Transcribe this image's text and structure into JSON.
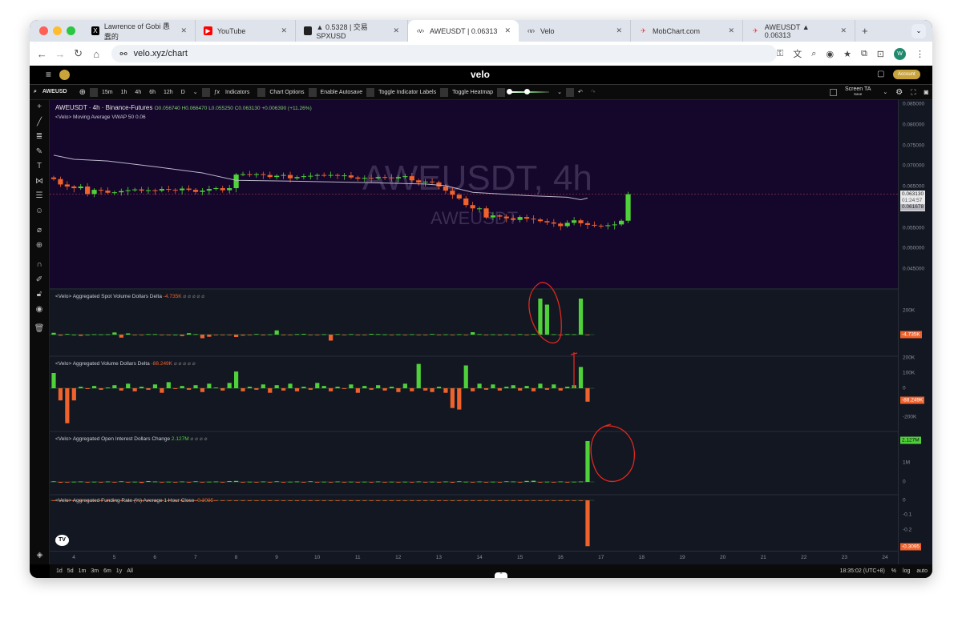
{
  "browser": {
    "tabs": [
      {
        "label": "Lawrence of Gobi 愚蠢的",
        "icon": "x-logo-icon"
      },
      {
        "label": "YouTube",
        "icon": "youtube-icon"
      },
      {
        "label": "▲ 0.5328 | 交易 SPXUSD",
        "icon": "exchange-icon"
      },
      {
        "label": "AWEUSDT | 0.06313",
        "icon": "velo-icon",
        "active": true
      },
      {
        "label": "Velo",
        "icon": "velo-icon"
      },
      {
        "label": "MobChart.com",
        "icon": "mobchart-icon"
      },
      {
        "label": "AWEUSDT ▲ 0.06313",
        "icon": "mobchart-icon"
      }
    ],
    "url": "velo.xyz/chart",
    "profile_initial": "W"
  },
  "app": {
    "logo": "velo",
    "account_label": "Account"
  },
  "toolbar": {
    "symbol": "AWEUSD",
    "intervals": [
      "15m",
      "1h",
      "4h",
      "6h",
      "12h",
      "D"
    ],
    "indicators": "Indicators",
    "chart_options": "Chart Options",
    "autosave": "Enable Autosave",
    "toggle_labels": "Toggle Indicator Labels",
    "toggle_heatmap": "Toggle Heatmap",
    "screen_ta": "Screen TA",
    "save": "Save"
  },
  "main": {
    "title": "AWEUSDT · 4h · Binance-Futures",
    "ohlc": "O0.056740  H0.066470  L0.055250  C0.063130  +0.006390 (+11.26%)",
    "ma_label": "<Velo> Moving Average VWAP 50 0.06",
    "watermark": "AWEUSDT, 4h",
    "watermark_sub": "AWEUSDT",
    "price_ticks": [
      "0.085000",
      "0.080000",
      "0.075000",
      "0.070000",
      "0.065000",
      "0.055000",
      "0.050000",
      "0.045000"
    ],
    "last_price": "0.063130",
    "countdown": "01:24:57",
    "vwap_value": "0.061678"
  },
  "panes": [
    {
      "label": "<Velo> Aggregated Spot Volume Dollars Delta",
      "value": "-4.735K",
      "ticks": [
        "200K"
      ],
      "tag": "-4.735K"
    },
    {
      "label": "<Velo> Aggregated Volume Dollars Delta",
      "value": "-88.249K",
      "ticks": [
        "200K",
        "100K",
        "0",
        "-200K"
      ],
      "tag": "-88.249K"
    },
    {
      "label": "<Velo> Aggregated Open Interest Dollars Change",
      "value": "2.127M",
      "ticks": [
        "1M",
        "0"
      ],
      "tag": "2.127M"
    },
    {
      "label": "<Velo> Aggregated Funding Rate (%) Average 1 Hour Close",
      "value": "-0.3095",
      "ticks": [
        "0",
        "-0.1",
        "-0.2"
      ],
      "tag": "-0.3095"
    }
  ],
  "xaxis": [
    "4",
    "5",
    "6",
    "7",
    "8",
    "9",
    "10",
    "11",
    "12",
    "13",
    "14",
    "15",
    "16",
    "17",
    "18",
    "19",
    "20",
    "21",
    "22",
    "23",
    "24"
  ],
  "bottom": {
    "ranges": [
      "1d",
      "5d",
      "1m",
      "3m",
      "6m",
      "1y",
      "All"
    ],
    "time": "18:35:02 (UTC+8)",
    "pct": "%",
    "log": "log",
    "auto": "auto"
  },
  "colors": {
    "up": "#4fd13a",
    "down": "#f0622c",
    "main_bg": "#15062b",
    "pane_bg": "#131722",
    "annot": "#e0281e"
  },
  "chart_data": {
    "type": "candlestick",
    "first_open": 0.0672,
    "close": [
      0.0668,
      0.0655,
      0.065,
      0.0646,
      0.065,
      0.0632,
      0.0642,
      0.064,
      0.0635,
      0.0636,
      0.0639,
      0.0641,
      0.0643,
      0.064,
      0.0641,
      0.064,
      0.0644,
      0.0642,
      0.0641,
      0.0645,
      0.0642,
      0.0637,
      0.064,
      0.0644,
      0.0646,
      0.0641,
      0.0646,
      0.0679,
      0.068,
      0.0679,
      0.068,
      0.0678,
      0.0673,
      0.0676,
      0.0678,
      0.067,
      0.0673,
      0.0675,
      0.0676,
      0.0678,
      0.0677,
      0.0678,
      0.0676,
      0.0677,
      0.0672,
      0.0669,
      0.0671,
      0.067,
      0.0673,
      0.0672,
      0.067,
      0.0673,
      0.0675,
      0.0665,
      0.066,
      0.0662,
      0.066,
      0.065,
      0.064,
      0.063,
      0.0621,
      0.0605,
      0.0597,
      0.0597,
      0.0575,
      0.058,
      0.0577,
      0.0573,
      0.0569,
      0.0576,
      0.0572,
      0.057,
      0.0566,
      0.0563,
      0.056,
      0.0554,
      0.0562,
      0.0568,
      0.0561,
      0.0557,
      0.0555,
      0.0554,
      0.0556,
      0.0558,
      0.0567,
      0.06313
    ],
    "vwap": [
      [
        0,
        0.0726
      ],
      [
        3,
        0.0716
      ],
      [
        8,
        0.0712
      ],
      [
        15,
        0.0698
      ],
      [
        22,
        0.0683
      ],
      [
        27,
        0.0665
      ],
      [
        35,
        0.0663
      ],
      [
        45,
        0.066
      ],
      [
        55,
        0.0656
      ],
      [
        58,
        0.0652
      ],
      [
        62,
        0.0636
      ],
      [
        70,
        0.0628
      ],
      [
        76,
        0.0624
      ],
      [
        78,
        0.0618
      ],
      [
        79,
        0.0622
      ]
    ],
    "ylim": [
      0.045,
      0.085
    ],
    "spot_delta_k": [
      15,
      -8,
      5,
      0,
      -10,
      0,
      3,
      2,
      3,
      18,
      -25,
      10,
      -3,
      -2,
      4,
      4,
      -3,
      -4,
      0,
      -12,
      12,
      4,
      -30,
      -18,
      -5,
      -3,
      -5,
      -20,
      -8,
      -4,
      5,
      -6,
      2,
      35,
      -3,
      -2,
      4,
      6,
      -3,
      -3,
      3,
      -50,
      4,
      -5,
      4,
      -2,
      -3,
      6,
      4,
      2,
      -3,
      2,
      -4,
      3,
      -2,
      -4,
      5,
      -3,
      2,
      -4,
      3,
      -5,
      20,
      4,
      -3,
      2,
      -6,
      3,
      -2,
      4,
      -3,
      5,
      300,
      250,
      3,
      -2,
      4,
      3,
      300,
      -4.735
    ],
    "volume_delta_k": [
      100,
      -80,
      -230,
      -80,
      10,
      -5,
      15,
      -10,
      5,
      20,
      -15,
      30,
      -20,
      10,
      -10,
      25,
      -30,
      40,
      -5,
      15,
      -10,
      20,
      -25,
      30,
      5,
      -15,
      35,
      110,
      -20,
      10,
      -10,
      25,
      -30,
      20,
      -15,
      30,
      -20,
      10,
      -10,
      35,
      15,
      -20,
      10,
      -5,
      25,
      -30,
      15,
      -10,
      20,
      -15,
      10,
      -25,
      30,
      -20,
      160,
      -15,
      -25,
      10,
      -30,
      -130,
      -140,
      150,
      -20,
      30,
      -10,
      25,
      -15,
      10,
      20,
      -15,
      15,
      -20,
      30,
      -10,
      25,
      -15,
      10,
      20,
      140,
      -88.249
    ],
    "oi_change_m": [
      0.03,
      -0.04,
      -0.03,
      0.01,
      0.02,
      -0.01,
      0.01,
      -0.02,
      0.02,
      -0.03,
      0.03,
      -0.02,
      0.01,
      -0.05,
      0.04,
      0.02,
      -0.03,
      0.01,
      -0.01,
      0.02,
      -0.01,
      0.03,
      -0.02,
      0.01,
      0.02,
      -0.03,
      0.04,
      0.05,
      -0.02,
      0.01,
      -0.03,
      0.02,
      -0.01,
      0.03,
      -0.02,
      0.01,
      0.02,
      -0.01,
      0.03,
      -0.02,
      0.01,
      -0.02,
      0.02,
      -0.01,
      0.01,
      -0.02,
      0.01,
      -0.03,
      0.02,
      -0.01,
      0.01,
      -0.02,
      0.01,
      -0.01,
      0.02,
      -0.03,
      0.01,
      -0.01,
      0.02,
      -0.04,
      0.03,
      0.01,
      -0.02,
      0.02,
      -0.03,
      0.01,
      -0.02,
      0.03,
      0.02,
      -0.01,
      0.05,
      0.06,
      -0.02,
      0.01,
      -0.01,
      0.02,
      -0.01,
      0.01,
      0.02,
      2.127
    ],
    "funding_pct": [
      -0.003,
      -0.003,
      -0.003,
      -0.003,
      -0.003,
      -0.003,
      -0.003,
      -0.003,
      -0.003,
      -0.003,
      -0.003,
      -0.003,
      -0.003,
      -0.003,
      -0.003,
      -0.003,
      -0.003,
      -0.003,
      -0.003,
      -0.003,
      -0.003,
      -0.003,
      -0.003,
      -0.003,
      -0.003,
      -0.003,
      -0.003,
      -0.003,
      -0.003,
      -0.003,
      -0.003,
      -0.003,
      -0.003,
      -0.003,
      -0.003,
      -0.003,
      -0.003,
      -0.003,
      -0.003,
      -0.003,
      -0.003,
      -0.003,
      -0.003,
      -0.003,
      -0.003,
      -0.003,
      -0.003,
      -0.003,
      -0.003,
      -0.003,
      -0.003,
      -0.003,
      -0.003,
      -0.003,
      -0.003,
      -0.003,
      -0.003,
      -0.003,
      -0.003,
      -0.003,
      -0.003,
      -0.003,
      -0.003,
      -0.003,
      -0.003,
      -0.003,
      -0.003,
      -0.003,
      -0.003,
      -0.003,
      -0.003,
      -0.003,
      -0.003,
      -0.003,
      -0.003,
      -0.003,
      -0.003,
      -0.003,
      -0.003,
      -0.3095
    ]
  }
}
